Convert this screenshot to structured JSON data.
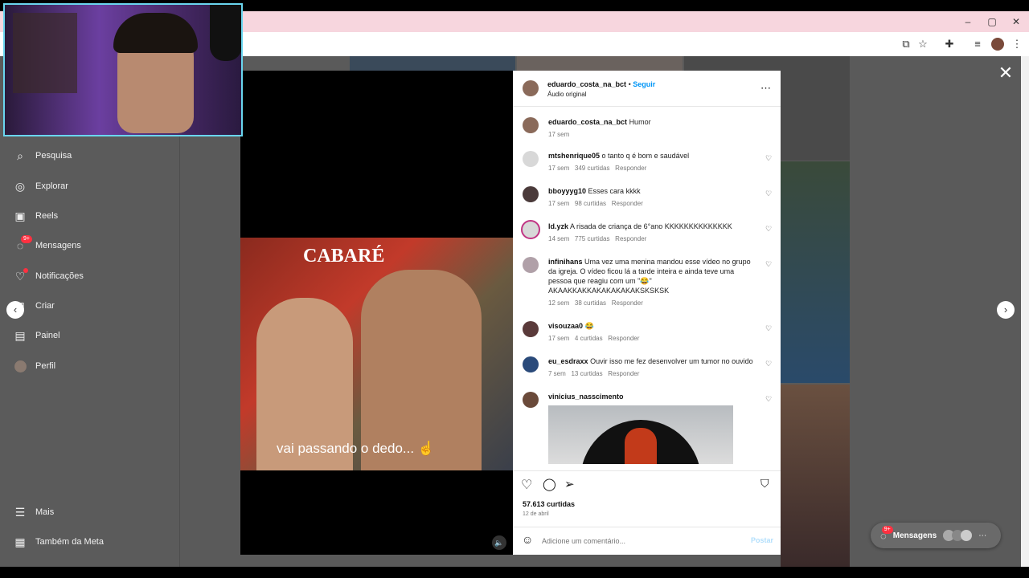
{
  "browser": {
    "window_buttons": [
      "–",
      "▢",
      "✕"
    ]
  },
  "sidebar": {
    "items": [
      {
        "label": "Pesquisa",
        "icon": "search-icon"
      },
      {
        "label": "Explorar",
        "icon": "compass-icon"
      },
      {
        "label": "Reels",
        "icon": "reels-icon"
      },
      {
        "label": "Mensagens",
        "icon": "messenger-icon",
        "badge": "9+"
      },
      {
        "label": "Notificações",
        "icon": "heart-icon"
      },
      {
        "label": "Criar",
        "icon": "plus-square-icon"
      },
      {
        "label": "Painel",
        "icon": "chart-icon"
      },
      {
        "label": "Perfil",
        "icon": "avatar-icon"
      }
    ],
    "bottom": [
      {
        "label": "Mais",
        "icon": "menu-icon"
      },
      {
        "label": "Também da Meta",
        "icon": "meta-icon"
      }
    ]
  },
  "post": {
    "author": "eduardo_costa_na_bct",
    "follow": "Seguir",
    "separator": "•",
    "audio": "Áudio original",
    "caption": "Humor",
    "caption_time": "17 sem",
    "video_caption": "vai passando o dedo...",
    "video_sign": "CABARÉ",
    "likes": "57.613 curtidas",
    "date": "12 de abril",
    "comment_placeholder": "Adicione um comentário...",
    "post_button": "Postar"
  },
  "comments": [
    {
      "user": "mtshenrique05",
      "text": "o tanto q é bom e saudável",
      "time": "17 sem",
      "likes": "349 curtidas",
      "reply": "Responder"
    },
    {
      "user": "bboyyyg10",
      "text": "Esses cara kkkk",
      "time": "17 sem",
      "likes": "98 curtidas",
      "reply": "Responder"
    },
    {
      "user": "ld.yzk",
      "text": "A risada de criança de 6°ano KKKKKKKKKKKKKK",
      "time": "14 sem",
      "likes": "775 curtidas",
      "reply": "Responder"
    },
    {
      "user": "infinihans",
      "text": "Uma vez uma menina mandou esse vídeo no grupo da igreja. O vídeo ficou lá a tarde inteira e ainda teve uma pessoa que reagiu com um \"😂\" AKAAKKAKKAKAKAKAKAKSKSKSK",
      "time": "12 sem",
      "likes": "38 curtidas",
      "reply": "Responder"
    },
    {
      "user": "visouzaa0",
      "text": "😂",
      "time": "17 sem",
      "likes": "4 curtidas",
      "reply": "Responder"
    },
    {
      "user": "eu_esdraxx",
      "text": "Ouvir isso me fez desenvolver um tumor no ouvido",
      "time": "7 sem",
      "likes": "13 curtidas",
      "reply": "Responder"
    },
    {
      "user": "vinicius_nasscimento",
      "text": "",
      "time": "",
      "likes": "",
      "reply": ""
    }
  ],
  "messages_pill": {
    "label": "Mensagens",
    "badge": "9+"
  },
  "colors": {
    "accent": "#0095f6",
    "badge": "#ff3040",
    "webcam_border": "#6ad6ef"
  }
}
